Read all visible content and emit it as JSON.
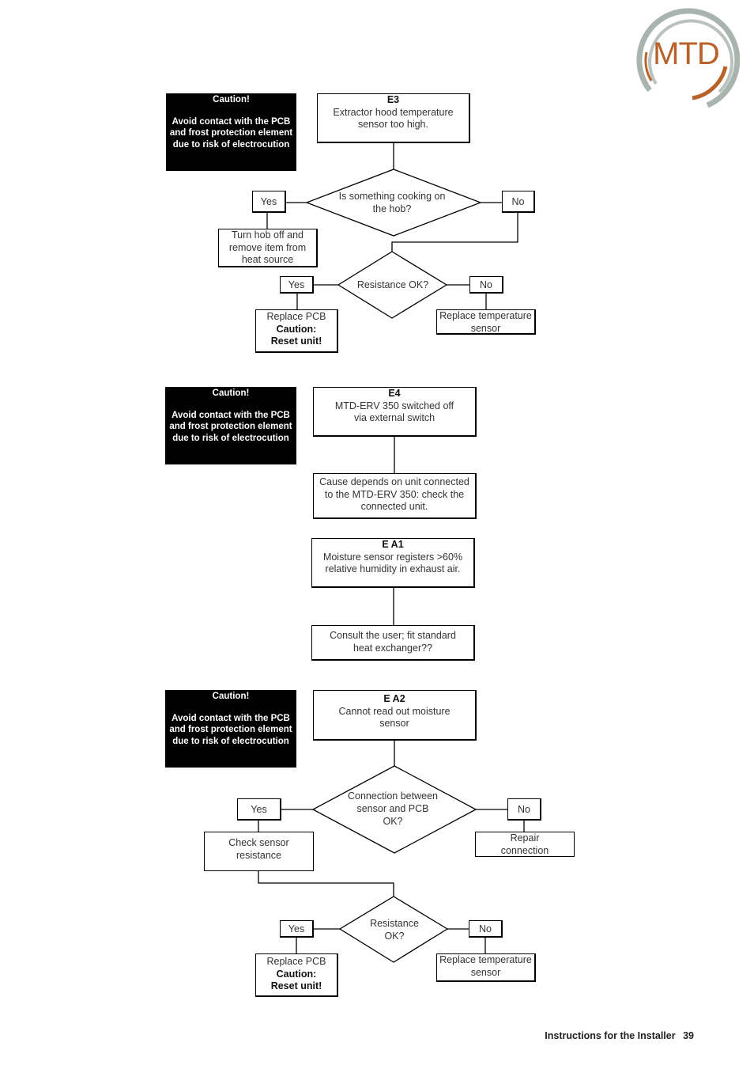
{
  "logo": {
    "text": "MTD",
    "colors": {
      "ring": "#a9b4ae",
      "accent": "#b8622a"
    }
  },
  "caution": {
    "title": "Caution!",
    "body": "Avoid contact with the PCB and frost protection element due to risk of electrocution"
  },
  "flows": {
    "e3": {
      "code": "E3",
      "description": "Extractor hood temperature sensor too high.",
      "question1": "Is something cooking on the hob?",
      "yes1": "Yes",
      "no1": "No",
      "yes1_action": "Turn hob off and remove item from heat source",
      "question2": "Resistance OK?",
      "yes2": "Yes",
      "no2": "No",
      "yes2_action": "Replace PCB",
      "yes2_caution": "Caution:",
      "yes2_reset": "Reset unit!",
      "no2_action": "Replace temperature sensor"
    },
    "e4": {
      "code": "E4",
      "description": "MTD-ERV 350 switched off via external switch",
      "action": "Cause depends on unit connected to the MTD-ERV 350: check the connected unit."
    },
    "ea1": {
      "code": "E A1",
      "description": "Moisture sensor registers >60% relative humidity in exhaust air.",
      "action": "Consult the user; fit standard heat exchanger??"
    },
    "ea2": {
      "code": "E A2",
      "description": "Cannot read out moisture sensor",
      "question1": "Connection between sensor and PCB OK?",
      "yes1": "Yes",
      "no1": "No",
      "yes1_action": "Check sensor resistance",
      "no1_action": "Repair connection",
      "question2": "Resistance OK?",
      "yes2": "Yes",
      "no2": "No",
      "yes2_action": "Replace PCB",
      "yes2_caution": "Caution:",
      "yes2_reset": "Reset unit!",
      "no2_action": "Replace temperature sensor"
    }
  },
  "footer": {
    "title": "Instructions for the Installer",
    "page": "39"
  }
}
